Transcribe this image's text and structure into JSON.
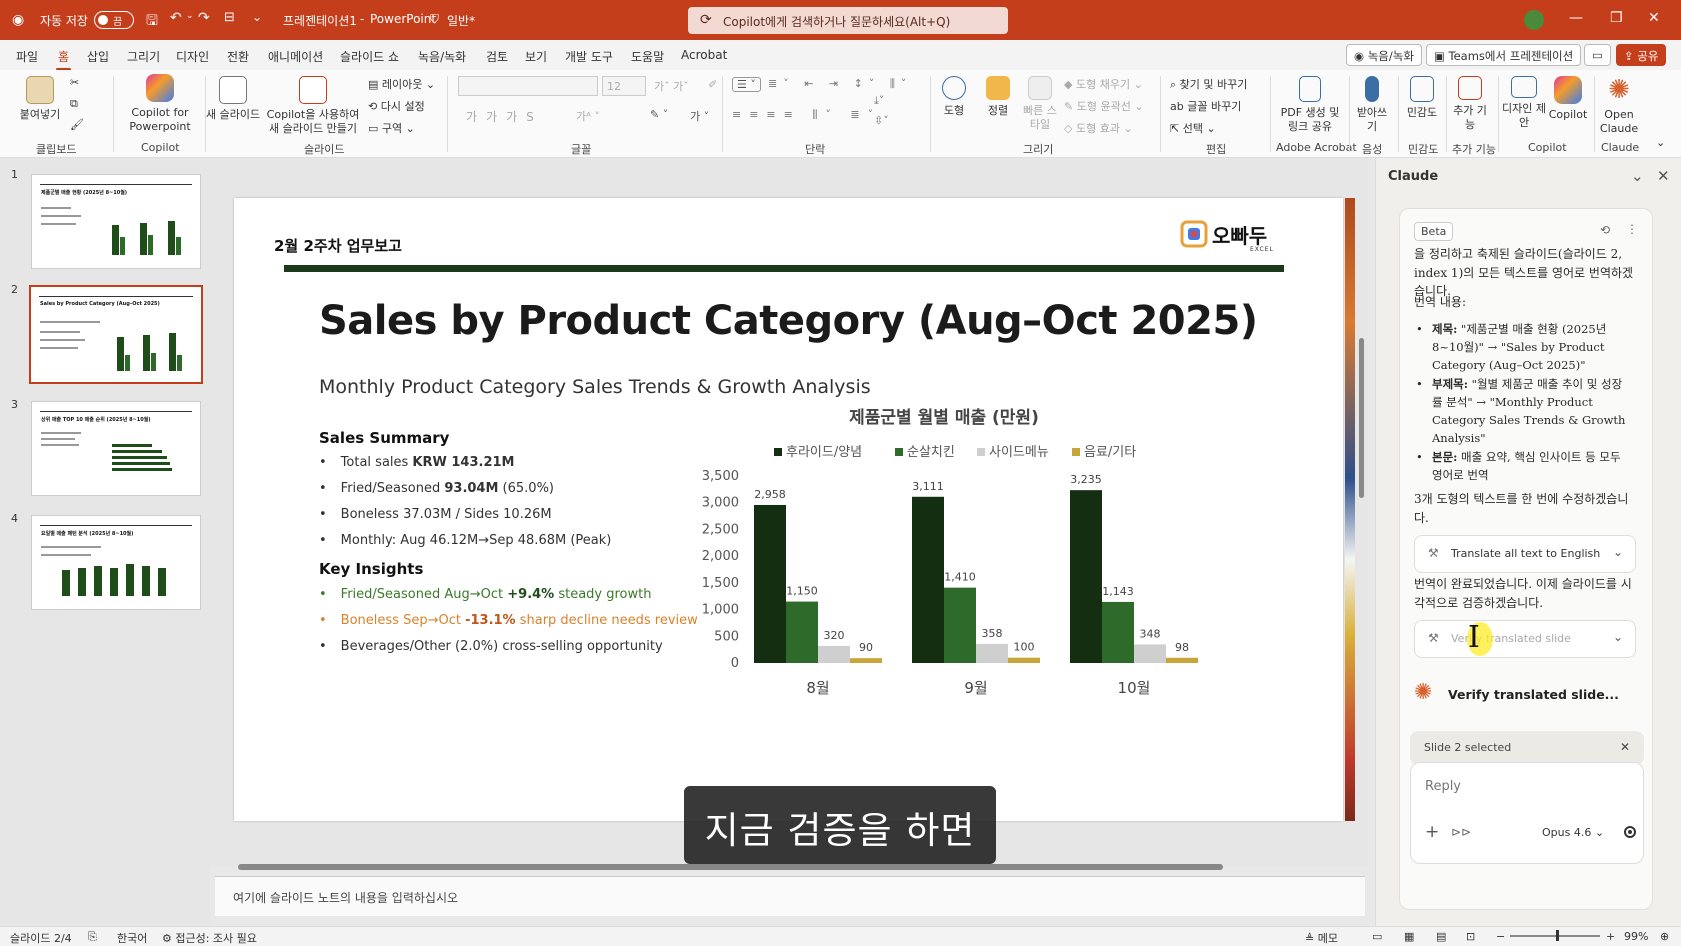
{
  "titlebar": {
    "autosave_label": "자동 저장",
    "autosave_state": "끔",
    "doc_title": "프레젠테이션1",
    "app_name": "PowerPoint",
    "sensitivity": "일반*",
    "search_placeholder": "Copilot에게 검색하거나 질문하세요(Alt+Q)",
    "quick_access_more": "⌄"
  },
  "menu": {
    "tabs": [
      "파일",
      "홈",
      "삽입",
      "그리기",
      "디자인",
      "전환",
      "애니메이션",
      "슬라이드 쇼",
      "녹음/녹화",
      "검토",
      "보기",
      "개발 도구",
      "도움말",
      "Acrobat"
    ],
    "active_tab": "홈",
    "record_btn": "녹음/녹화",
    "teams_btn": "Teams에서 프레젠테이션",
    "share_btn": "공유"
  },
  "ribbon": {
    "paste": "붙여넣기",
    "clipboard_group": "클립보드",
    "copilot_ppt": "Copilot for Powerpoint",
    "copilot_group": "Copilot",
    "new_slide": "새 슬라이드",
    "copilot_new_slide": "Copilot을 사용하여 새 슬라이드 만들기",
    "layout": "레이아웃",
    "reset": "다시 설정",
    "section": "구역",
    "slides_group": "슬라이드",
    "font_size": "12",
    "font_group": "글꼴",
    "paragraph_group": "단락",
    "shape": "도형",
    "arrange": "정렬",
    "quick_styles": "빠른 스타일",
    "shape_fill": "도형 채우기",
    "shape_outline": "도형 윤곽선",
    "shape_effects": "도형 효과",
    "drawing_group": "그리기",
    "find_replace": "찾기 및 바꾸기",
    "replace_font": "글꼴 바꾸기",
    "select": "선택",
    "edit_group": "편집",
    "pdf_share": "PDF 생성 및 링크 공유",
    "acrobat_group": "Adobe Acrobat",
    "dictate": "받아쓰기",
    "voice_group": "음성",
    "sensitivity": "민감도",
    "sensitivity_group": "민감도",
    "add_ins": "추가 기능",
    "add_ins_group": "추가 기능",
    "designer": "디자인 제안",
    "copilot": "Copilot",
    "copilot_group2": "Copilot",
    "open_claude": "Open Claude",
    "claude_group": "Claude"
  },
  "thumbnails": [
    {
      "num": "1",
      "title": "제품군별 매출 현황 (2025년 8~10월)"
    },
    {
      "num": "2",
      "title": "Sales by Product Category (Aug–Oct 2025)"
    },
    {
      "num": "3",
      "title": "상위 매출 TOP 10 매출 순위 (2025년 8~10월)"
    },
    {
      "num": "4",
      "title": "요일별 매출 패턴 분석 (2025년 8~10월)"
    }
  ],
  "slide": {
    "top_label": "2월 2주차 업무보고",
    "logo_text": "오빠두",
    "logo_sub": "EXCEL",
    "title": "Sales by Product Category (Aug–Oct 2025)",
    "subtitle": "Monthly Product Category Sales Trends & Growth Analysis",
    "summary_heading": "Sales Summary",
    "summary": [
      {
        "pre": "Total sales ",
        "bold": "KRW 143.21M",
        "post": ""
      },
      {
        "pre": "Fried/Seasoned ",
        "bold": "93.04M",
        "post": " (65.0%)"
      },
      {
        "pre": "Boneless 37.03M / Sides 10.26M",
        "bold": "",
        "post": ""
      },
      {
        "pre": "Monthly: Aug 46.12M→Sep 48.68M (Peak)",
        "bold": "",
        "post": ""
      }
    ],
    "insights_heading": "Key Insights",
    "insights": [
      {
        "pre": "Fried/Seasoned Aug→Oct ",
        "bold": "+9.4%",
        "post": " steady growth"
      },
      {
        "pre": "Boneless Sep→Oct ",
        "bold": "-13.1%",
        "post": " sharp decline needs review"
      },
      {
        "pre": "Beverages/Other (2.0%) cross-selling opportunity",
        "bold": "",
        "post": ""
      }
    ]
  },
  "chart_data": {
    "type": "bar",
    "title": "제품군별 월별 매출 (만원)",
    "categories": [
      "8월",
      "9월",
      "10월"
    ],
    "series": [
      {
        "name": "후라이드/양념",
        "color": "#142e12",
        "values": [
          2958,
          3111,
          3235
        ]
      },
      {
        "name": "순살치킨",
        "color": "#2e6b2b",
        "values": [
          1150,
          1410,
          1143
        ]
      },
      {
        "name": "사이드메뉴",
        "color": "#cfcfcf",
        "values": [
          320,
          358,
          348
        ]
      },
      {
        "name": "음료/기타",
        "color": "#c9a43a",
        "values": [
          90,
          100,
          98
        ]
      }
    ],
    "ylim": [
      0,
      3500
    ],
    "yticks": [
      "3,500",
      "3,000",
      "2,500",
      "2,000",
      "1,500",
      "1,000",
      "500",
      "0"
    ],
    "legend": "top",
    "grid": false
  },
  "caption": "지금 검증을 하면",
  "notes_placeholder": "여기에 슬라이드 노트의 내용을 입력하십시오",
  "claude": {
    "title": "Claude",
    "badge": "Beta",
    "intro": "을 정리하고 축제된 슬라이드(슬라이드 2, index 1)의 모든 텍스트를 영어로 번역하겠습니다.",
    "translation_heading": "번역 내용:",
    "bullets": [
      {
        "label": "제목:",
        "text": " \"제품군별 매출 현황 (2025년 8~10월)\" → \"Sales by Product Category (Aug–Oct 2025)\""
      },
      {
        "label": "부제목:",
        "text": " \"월별 제품군 매출 추이 및 성장률 분석\" → \"Monthly Product Category Sales Trends & Growth Analysis\""
      },
      {
        "label": "본문:",
        "text": " 매출 요약, 핵심 인사이트 등 모두 영어로 번역"
      }
    ],
    "edit_note": "3개 도형의 텍스트를 한 번에 수정하겠습니다.",
    "tool1": "Translate all text to English",
    "result_note": "번역이 완료되었습니다. 이제 슬라이드를 시각적으로 검증하겠습니다.",
    "tool2": "Verify translated slide",
    "status": "Verify translated slide...",
    "selection": "Slide 2 selected",
    "reply_placeholder": "Reply",
    "model": "Opus 4.6"
  },
  "statusbar": {
    "slide_pos": "슬라이드 2/4",
    "language": "한국어",
    "accessibility": "접근성: 조사 필요",
    "notes": "메모",
    "zoom": "99%"
  }
}
